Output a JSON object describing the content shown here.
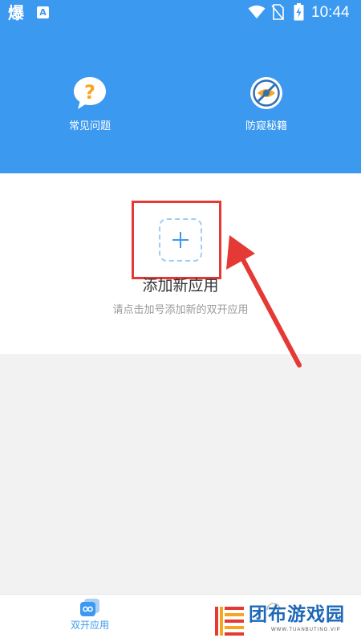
{
  "status_bar": {
    "left_glyph": "爆",
    "notification_letter": "A",
    "icons": [
      "wifi-icon",
      "no-sim-icon",
      "battery-charging-icon"
    ],
    "time": "10:44"
  },
  "header": {
    "background": "#3b99f0",
    "features": [
      {
        "icon": "question-bubble-icon",
        "label": "常见问题"
      },
      {
        "icon": "shield-eye-icon",
        "label": "防窥秘籍"
      }
    ]
  },
  "main": {
    "add_button_icon": "plus-icon",
    "title": "添加新应用",
    "subtitle": "请点击加号添加新的双开应用",
    "annotation_color": "#e53935"
  },
  "bottom_nav": {
    "items": [
      {
        "icon": "dual-app-icon",
        "label": "双开应用",
        "active": true
      },
      {
        "icon": "nav-icon-partial",
        "label": "",
        "active": false
      }
    ]
  },
  "watermark": {
    "text": "团布游戏园",
    "url": "WWW.TUANBUTING.VIP"
  }
}
